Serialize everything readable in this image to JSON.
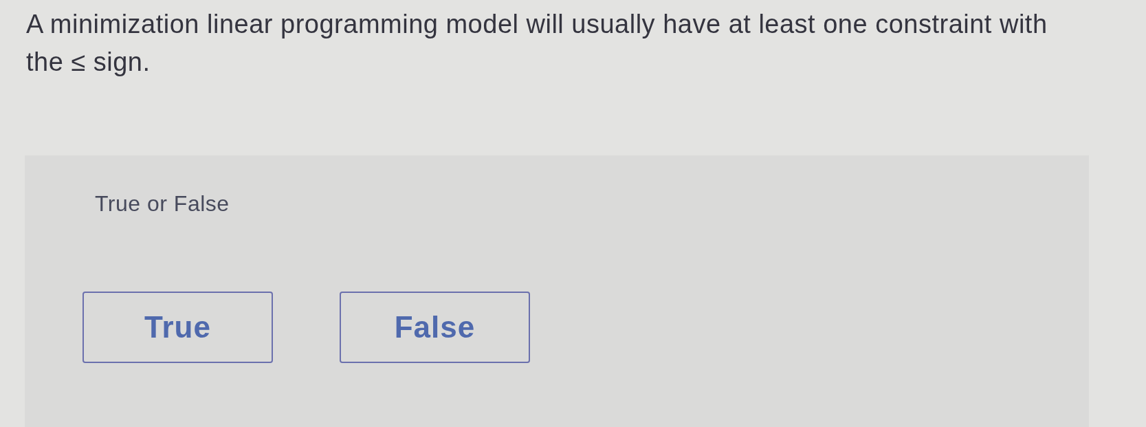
{
  "question": {
    "text": "A minimization linear programming model will usually have at least one constraint with the ≤ sign."
  },
  "answer_panel": {
    "label": "True or False",
    "options": [
      {
        "label": "True",
        "selected": false
      },
      {
        "label": "False",
        "selected": false
      }
    ]
  }
}
